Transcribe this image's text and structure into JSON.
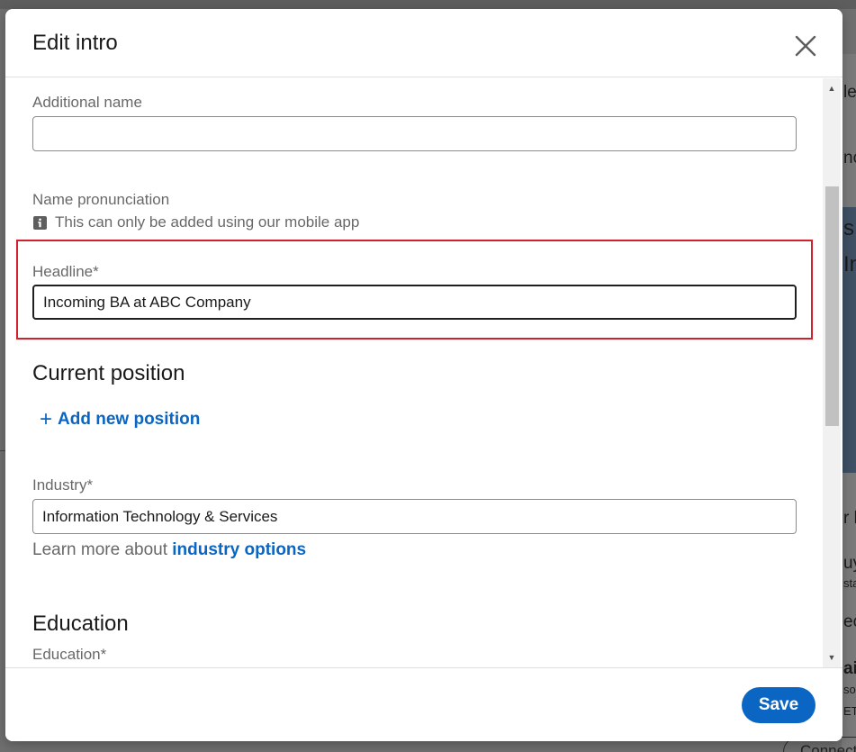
{
  "modal": {
    "title": "Edit intro",
    "close_icon": "close-icon"
  },
  "fields": {
    "additional_name": {
      "label": "Additional name",
      "value": ""
    },
    "name_pronunciation": {
      "label": "Name pronunciation",
      "info_text": "This can only be added using our mobile app",
      "info_icon": "info-icon"
    },
    "headline": {
      "label": "Headline*",
      "value": "Incoming BA at ABC Company"
    },
    "current_position": {
      "title": "Current position",
      "add_label": "Add new position"
    },
    "industry": {
      "label": "Industry*",
      "value": "Information Technology & Services",
      "learn_more_prefix": "Learn more about ",
      "learn_more_link": "industry options"
    },
    "education": {
      "title": "Education",
      "label": "Education*",
      "value": ""
    }
  },
  "footer": {
    "save_label": "Save"
  },
  "background": {
    "fragments": [
      "le",
      "nc",
      "s",
      "In",
      "r k",
      "uy",
      "sta",
      "ec",
      "ai",
      "so",
      "ET",
      "Connect"
    ]
  },
  "colors": {
    "brand_blue": "#0a66c2",
    "highlight_red": "#d0222c",
    "overlay": "#6f6f6f"
  }
}
